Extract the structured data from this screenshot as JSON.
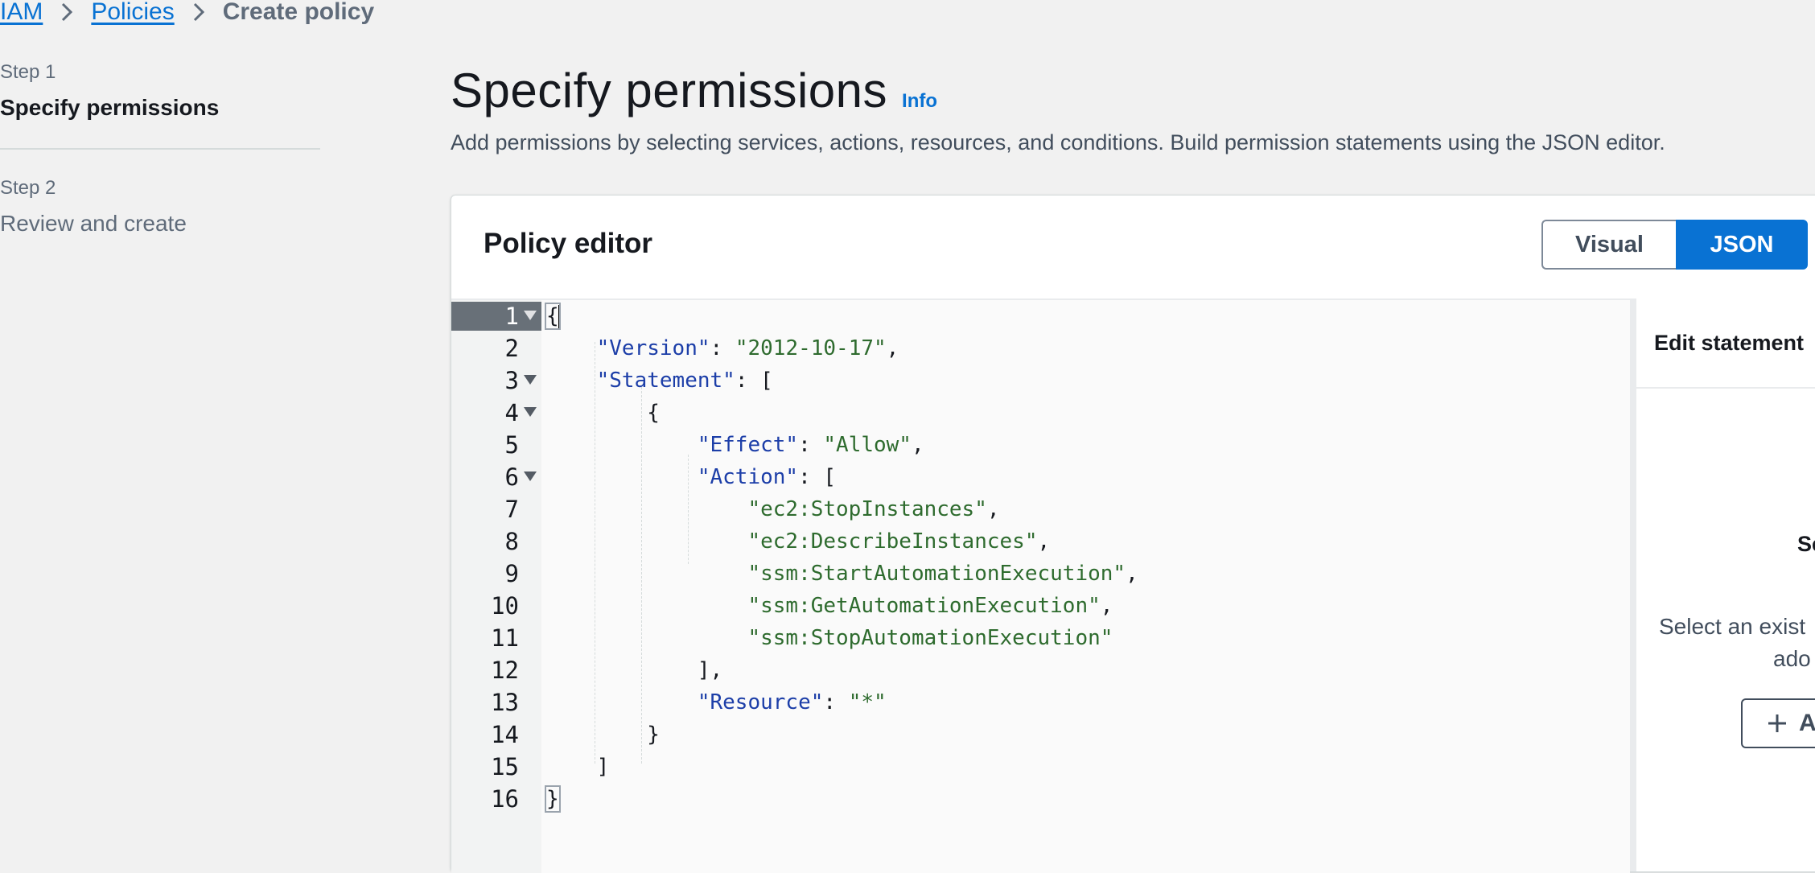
{
  "breadcrumb": {
    "items": [
      "IAM",
      "Policies"
    ],
    "current": "Create policy"
  },
  "steps": [
    {
      "label": "Step 1",
      "title": "Specify permissions",
      "active": true
    },
    {
      "label": "Step 2",
      "title": "Review and create",
      "active": false
    }
  ],
  "page": {
    "title": "Specify permissions",
    "info": "Info",
    "description": "Add permissions by selecting services, actions, resources, and conditions. Build permission statements using the JSON editor."
  },
  "editor": {
    "title": "Policy editor",
    "modes": [
      "Visual",
      "JSON"
    ],
    "selected_mode": "JSON",
    "active_line": 1,
    "lines": [
      "1",
      "2",
      "3",
      "4",
      "5",
      "6",
      "7",
      "8",
      "9",
      "10",
      "11",
      "12",
      "13",
      "14",
      "15",
      "16"
    ],
    "tokens": {
      "version_key": "\"Version\"",
      "version_val": "\"2012-10-17\"",
      "statement_key": "\"Statement\"",
      "effect_key": "\"Effect\"",
      "effect_val": "\"Allow\"",
      "action_key": "\"Action\"",
      "actions": [
        "\"ec2:StopInstances\"",
        "\"ec2:DescribeInstances\"",
        "\"ssm:StartAutomationExecution\"",
        "\"ssm:GetAutomationExecution\"",
        "\"ssm:StopAutomationExecution\""
      ],
      "resource_key": "\"Resource\"",
      "resource_val": "\"*\""
    }
  },
  "side_panel": {
    "title": "Edit statement",
    "subtitle": "Se",
    "text_line1": "Select an exist",
    "text_line2": "ado",
    "button": "A"
  },
  "colors": {
    "accent": "#0972d3",
    "key": "#1c3ea8",
    "string": "#2e6b2e"
  }
}
